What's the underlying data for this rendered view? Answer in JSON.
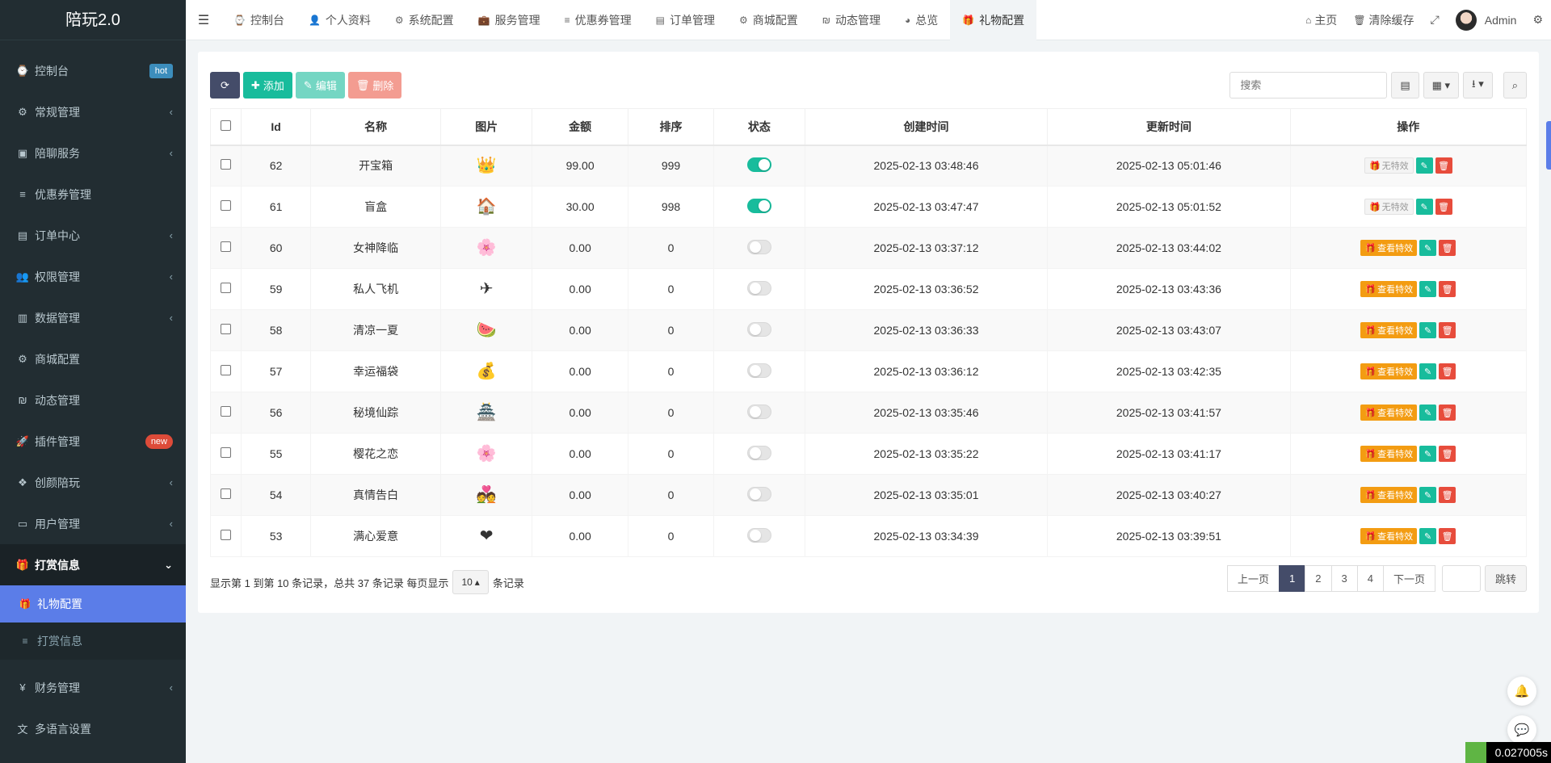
{
  "app": {
    "title": "陪玩2.0"
  },
  "sidebar": {
    "items": [
      {
        "icon": "⌚",
        "icon_name": "dashboard-icon",
        "label": "控制台",
        "badge": "hot",
        "badge_color": "blue"
      },
      {
        "icon": "⚙",
        "icon_name": "cogs-icon",
        "label": "常规管理",
        "chevron": "‹"
      },
      {
        "icon": "▣",
        "icon_name": "service-icon",
        "label": "陪聊服务",
        "chevron": "‹"
      },
      {
        "icon": "≡",
        "icon_name": "list-icon",
        "label": "优惠券管理"
      },
      {
        "icon": "▤",
        "icon_name": "file-icon",
        "label": "订单中心",
        "chevron": "‹"
      },
      {
        "icon": "👥",
        "icon_name": "users-icon",
        "label": "权限管理",
        "chevron": "‹"
      },
      {
        "icon": "▥",
        "icon_name": "bar-chart-icon",
        "label": "数据管理",
        "chevron": "‹"
      },
      {
        "icon": "⚙",
        "icon_name": "cogs-icon",
        "label": "商城配置"
      },
      {
        "icon": "₪",
        "icon_name": "moments-icon",
        "label": "动态管理"
      },
      {
        "icon": "🚀",
        "icon_name": "rocket-icon",
        "label": "插件管理",
        "badge": "new",
        "badge_color": "red"
      },
      {
        "icon": "❖",
        "icon_name": "dropbox-icon",
        "label": "创颜陪玩",
        "chevron": "‹"
      },
      {
        "icon": "▭",
        "icon_name": "id-card-icon",
        "label": "用户管理",
        "chevron": "‹"
      }
    ],
    "open_group": {
      "icon": "🎁",
      "label": "打赏信息",
      "chevron": "⌄"
    },
    "sub_items": [
      {
        "icon": "🎁",
        "label": "礼物配置",
        "active": true
      },
      {
        "icon": "≡",
        "label": "打赏信息",
        "active": false
      }
    ],
    "bottom_items": [
      {
        "icon": "¥",
        "icon_name": "yen-icon",
        "label": "财务管理",
        "chevron": "‹"
      },
      {
        "icon": "文",
        "icon_name": "language-icon",
        "label": "多语言设置"
      }
    ]
  },
  "header": {
    "tabs": [
      {
        "icon": "⌚",
        "label": "控制台"
      },
      {
        "icon": "👤",
        "label": "个人资料"
      },
      {
        "icon": "⚙",
        "label": "系统配置"
      },
      {
        "icon": "💼",
        "label": "服务管理"
      },
      {
        "icon": "≡",
        "label": "优惠券管理"
      },
      {
        "icon": "▤",
        "label": "订单管理"
      },
      {
        "icon": "⚙",
        "label": "商城配置"
      },
      {
        "icon": "₪",
        "label": "动态管理"
      },
      {
        "icon": "◕",
        "label": "总览"
      },
      {
        "icon": "🎁",
        "label": "礼物配置",
        "active": true
      }
    ],
    "right": {
      "home": "主页",
      "clear_cache": "清除缓存",
      "user": "Admin"
    }
  },
  "toolbar": {
    "add": "添加",
    "edit": "编辑",
    "delete": "删除",
    "search_placeholder": "搜索"
  },
  "table": {
    "columns": [
      "Id",
      "名称",
      "图片",
      "金额",
      "排序",
      "状态",
      "创建时间",
      "更新时间",
      "操作"
    ],
    "rows": [
      {
        "id": "62",
        "name": "开宝箱",
        "img": "👑",
        "amount": "99.00",
        "sort": "999",
        "status": true,
        "created": "2025-02-13 03:48:46",
        "updated": "2025-02-13 05:01:46",
        "op_label": "无特效",
        "op_type": "none"
      },
      {
        "id": "61",
        "name": "盲盒",
        "img": "🏠",
        "amount": "30.00",
        "sort": "998",
        "status": true,
        "created": "2025-02-13 03:47:47",
        "updated": "2025-02-13 05:01:52",
        "op_label": "无特效",
        "op_type": "none"
      },
      {
        "id": "60",
        "name": "女神降临",
        "img": "🌸",
        "amount": "0.00",
        "sort": "0",
        "status": false,
        "created": "2025-02-13 03:37:12",
        "updated": "2025-02-13 03:44:02",
        "op_label": "查看特效",
        "op_type": "fx"
      },
      {
        "id": "59",
        "name": "私人飞机",
        "img": "✈",
        "amount": "0.00",
        "sort": "0",
        "status": false,
        "created": "2025-02-13 03:36:52",
        "updated": "2025-02-13 03:43:36",
        "op_label": "查看特效",
        "op_type": "fx"
      },
      {
        "id": "58",
        "name": "清凉一夏",
        "img": "🍉",
        "amount": "0.00",
        "sort": "0",
        "status": false,
        "created": "2025-02-13 03:36:33",
        "updated": "2025-02-13 03:43:07",
        "op_label": "查看特效",
        "op_type": "fx"
      },
      {
        "id": "57",
        "name": "幸运福袋",
        "img": "💰",
        "amount": "0.00",
        "sort": "0",
        "status": false,
        "created": "2025-02-13 03:36:12",
        "updated": "2025-02-13 03:42:35",
        "op_label": "查看特效",
        "op_type": "fx"
      },
      {
        "id": "56",
        "name": "秘境仙踪",
        "img": "🏯",
        "amount": "0.00",
        "sort": "0",
        "status": false,
        "created": "2025-02-13 03:35:46",
        "updated": "2025-02-13 03:41:57",
        "op_label": "查看特效",
        "op_type": "fx"
      },
      {
        "id": "55",
        "name": "樱花之恋",
        "img": "🌸",
        "amount": "0.00",
        "sort": "0",
        "status": false,
        "created": "2025-02-13 03:35:22",
        "updated": "2025-02-13 03:41:17",
        "op_label": "查看特效",
        "op_type": "fx"
      },
      {
        "id": "54",
        "name": "真情告白",
        "img": "💑",
        "amount": "0.00",
        "sort": "0",
        "status": false,
        "created": "2025-02-13 03:35:01",
        "updated": "2025-02-13 03:40:27",
        "op_label": "查看特效",
        "op_type": "fx"
      },
      {
        "id": "53",
        "name": "满心爱意",
        "img": "❤",
        "amount": "0.00",
        "sort": "0",
        "status": false,
        "created": "2025-02-13 03:34:39",
        "updated": "2025-02-13 03:39:51",
        "op_label": "查看特效",
        "op_type": "fx"
      }
    ]
  },
  "pagination": {
    "info_prefix": "显示第 1 到第 10 条记录，总共 37 条记录 每页显示",
    "page_size": "10",
    "info_suffix": "条记录",
    "prev": "上一页",
    "pages": [
      "1",
      "2",
      "3",
      "4"
    ],
    "current": "1",
    "next": "下一页",
    "jump": "跳转"
  },
  "timer": "0.027005s",
  "colors": {
    "sidebar_bg": "#222d32",
    "accent": "#444c69",
    "success": "#18bc9c",
    "warning": "#f39c12",
    "danger": "#e74c3c",
    "active_sub": "#5b7de8"
  }
}
